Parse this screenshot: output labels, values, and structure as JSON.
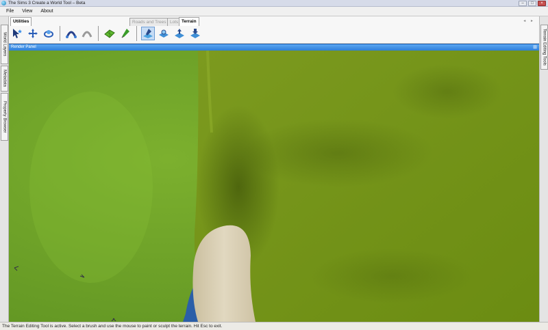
{
  "window": {
    "title": "The Sims 3 Create a World Tool – Beta"
  },
  "menu": [
    "File",
    "View",
    "About"
  ],
  "left_tabs": [
    "World Layers",
    "Metadata",
    "Property Browser"
  ],
  "right_tabs": [
    "Terrain Editing Tools"
  ],
  "tool_tabs": {
    "utilities": "Utilities",
    "roads_trees": "Roads and Trees",
    "lots": "Lots",
    "terrain": "Terrain"
  },
  "render_panel": {
    "title": "Render Panel"
  },
  "status": {
    "text": "The Terrain Editing Tool is active. Select a brush and use the mouse to paint or sculpt the terrain. Hit Esc to exit."
  },
  "colors": {
    "accent": "#2f7fd8",
    "terrain_light": "#6fa02a",
    "terrain_dark": "#5b7b10",
    "sand": "#d9cfb6"
  }
}
